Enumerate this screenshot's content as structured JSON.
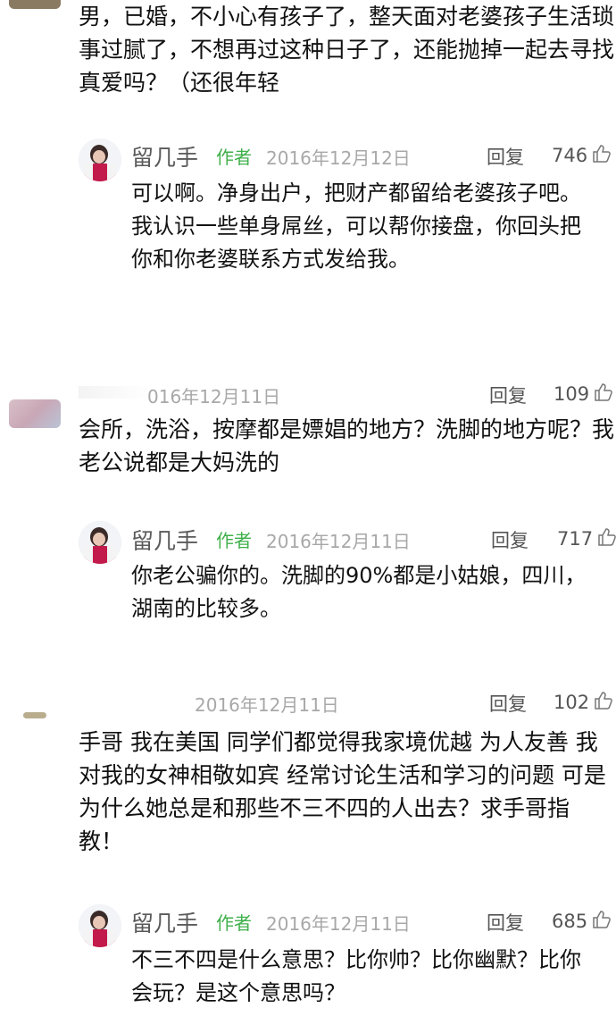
{
  "thread1": {
    "question": "男，已婚，不小心有孩子了，整天面对老婆孩子生活琐事过腻了，不想再过这种日子了，还能抛掉一起去寻找真爱吗？（还很年轻",
    "reply": {
      "nickname": "留几手",
      "author_tag": "作者",
      "date": "2016年12月12日",
      "reply_label": "回复",
      "likes": "746",
      "text": "可以啊。净身出户，把财产都留给老婆孩子吧。我认识一些单身屌丝，可以帮你接盘，你回头把你和你老婆联系方式发给我。"
    }
  },
  "thread2": {
    "date": "016年12月11日",
    "reply_label": "回复",
    "likes": "109",
    "question": "会所，洗浴，按摩都是嫖娼的地方？洗脚的地方呢？我老公说都是大妈洗的",
    "reply": {
      "nickname": "留几手",
      "author_tag": "作者",
      "date": "2016年12月11日",
      "reply_label": "回复",
      "likes": "717",
      "text": "你老公骗你的。洗脚的90%都是小姑娘，四川，湖南的比较多。"
    }
  },
  "thread3": {
    "date": "2016年12月11日",
    "reply_label": "回复",
    "likes": "102",
    "question": "手哥 我在美国 同学们都觉得我家境优越 为人友善 我对我的女神相敬如宾 经常讨论生活和学习的问题 可是为什么她总是和那些不三不四的人出去？求手哥指教！",
    "reply": {
      "nickname": "留几手",
      "author_tag": "作者",
      "date": "2016年12月11日",
      "reply_label": "回复",
      "likes": "685",
      "text": "不三不四是什么意思？比你帅？比你幽默？比你会玩？是这个意思吗？"
    }
  },
  "icons": {
    "like": "thumbs-up-icon",
    "avatar": "avatar-icon"
  }
}
